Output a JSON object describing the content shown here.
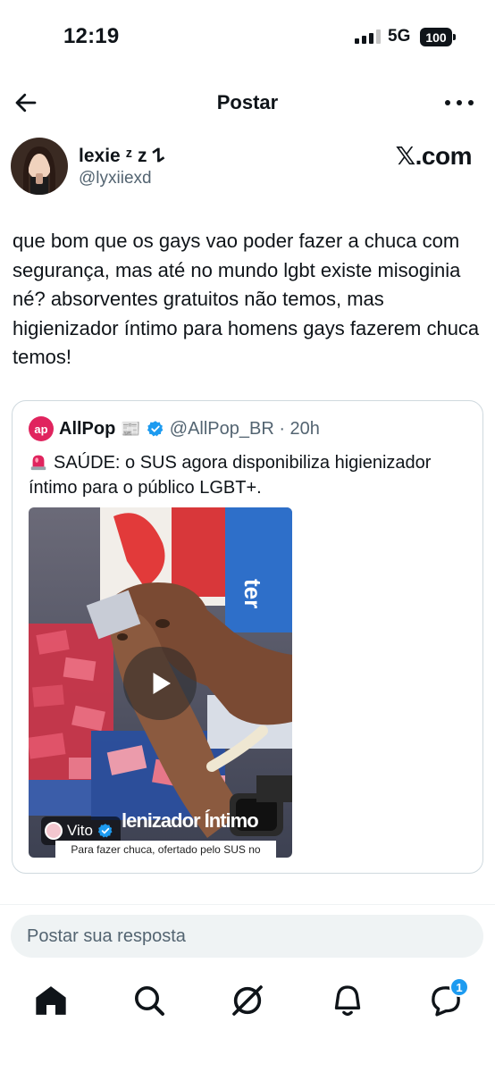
{
  "status_bar": {
    "time": "12:19",
    "network": "5G",
    "battery": "100"
  },
  "header": {
    "title": "Postar"
  },
  "post": {
    "author_name": "lexie ᶻ z 𐰁",
    "author_handle": "@lyxiiexd",
    "brand": "𝕏.com",
    "text": "que bom que os gays vao poder fazer a chuca com segurança, mas até no mundo lgbt existe misoginia né? absorventes gratuitos não temos, mas higienizador íntimo para homens gays fazerem chuca temos!"
  },
  "quoted_post": {
    "avatar_text": "ap",
    "author_name": "AllPop",
    "author_emoji": "📰",
    "handle_time": "@AllPop_BR · 20h",
    "text": "SAÚDE: o SUS agora disponibiliza higienizador íntimo para o público LGBT+.",
    "video": {
      "author_chip": "Vito",
      "title": "lenizador Íntimo",
      "subtitle": "Para fazer chuca, ofertado pelo SUS no"
    }
  },
  "reply": {
    "placeholder": "Postar sua resposta"
  },
  "bottom_nav": {
    "items": [
      "home",
      "search",
      "grok",
      "notifications",
      "messages"
    ],
    "messages_badge": "1"
  },
  "colors": {
    "verified": "#1d9bf0",
    "allpop_red": "#e0245e",
    "secondary_text": "#536471"
  }
}
